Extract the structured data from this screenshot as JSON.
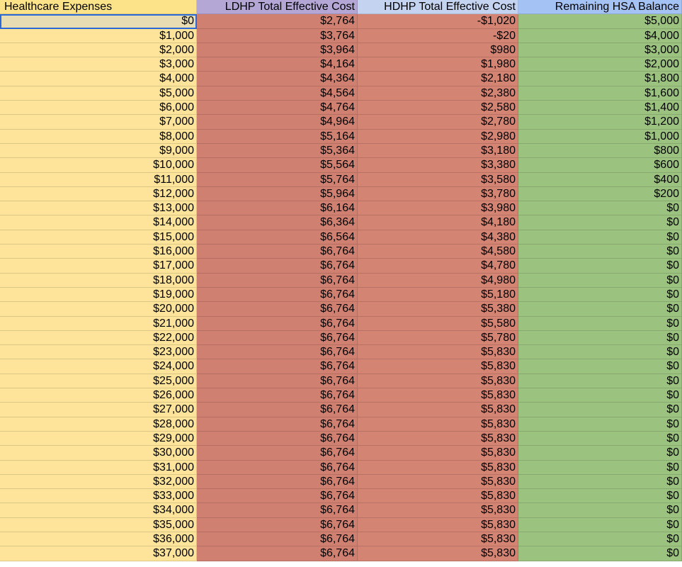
{
  "columns": [
    "Healthcare Expenses",
    "LDHP Total Effective Cost",
    "HDHP Total Effective Cost",
    "Remaining HSA Balance"
  ],
  "rows": [
    [
      "$0",
      "$2,764",
      "-$1,020",
      "$5,000"
    ],
    [
      "$1,000",
      "$3,764",
      "-$20",
      "$4,000"
    ],
    [
      "$2,000",
      "$3,964",
      "$980",
      "$3,000"
    ],
    [
      "$3,000",
      "$4,164",
      "$1,980",
      "$2,000"
    ],
    [
      "$4,000",
      "$4,364",
      "$2,180",
      "$1,800"
    ],
    [
      "$5,000",
      "$4,564",
      "$2,380",
      "$1,600"
    ],
    [
      "$6,000",
      "$4,764",
      "$2,580",
      "$1,400"
    ],
    [
      "$7,000",
      "$4,964",
      "$2,780",
      "$1,200"
    ],
    [
      "$8,000",
      "$5,164",
      "$2,980",
      "$1,000"
    ],
    [
      "$9,000",
      "$5,364",
      "$3,180",
      "$800"
    ],
    [
      "$10,000",
      "$5,564",
      "$3,380",
      "$600"
    ],
    [
      "$11,000",
      "$5,764",
      "$3,580",
      "$400"
    ],
    [
      "$12,000",
      "$5,964",
      "$3,780",
      "$200"
    ],
    [
      "$13,000",
      "$6,164",
      "$3,980",
      "$0"
    ],
    [
      "$14,000",
      "$6,364",
      "$4,180",
      "$0"
    ],
    [
      "$15,000",
      "$6,564",
      "$4,380",
      "$0"
    ],
    [
      "$16,000",
      "$6,764",
      "$4,580",
      "$0"
    ],
    [
      "$17,000",
      "$6,764",
      "$4,780",
      "$0"
    ],
    [
      "$18,000",
      "$6,764",
      "$4,980",
      "$0"
    ],
    [
      "$19,000",
      "$6,764",
      "$5,180",
      "$0"
    ],
    [
      "$20,000",
      "$6,764",
      "$5,380",
      "$0"
    ],
    [
      "$21,000",
      "$6,764",
      "$5,580",
      "$0"
    ],
    [
      "$22,000",
      "$6,764",
      "$5,780",
      "$0"
    ],
    [
      "$23,000",
      "$6,764",
      "$5,830",
      "$0"
    ],
    [
      "$24,000",
      "$6,764",
      "$5,830",
      "$0"
    ],
    [
      "$25,000",
      "$6,764",
      "$5,830",
      "$0"
    ],
    [
      "$26,000",
      "$6,764",
      "$5,830",
      "$0"
    ],
    [
      "$27,000",
      "$6,764",
      "$5,830",
      "$0"
    ],
    [
      "$28,000",
      "$6,764",
      "$5,830",
      "$0"
    ],
    [
      "$29,000",
      "$6,764",
      "$5,830",
      "$0"
    ],
    [
      "$30,000",
      "$6,764",
      "$5,830",
      "$0"
    ],
    [
      "$31,000",
      "$6,764",
      "$5,830",
      "$0"
    ],
    [
      "$32,000",
      "$6,764",
      "$5,830",
      "$0"
    ],
    [
      "$33,000",
      "$6,764",
      "$5,830",
      "$0"
    ],
    [
      "$34,000",
      "$6,764",
      "$5,830",
      "$0"
    ],
    [
      "$35,000",
      "$6,764",
      "$5,830",
      "$0"
    ],
    [
      "$36,000",
      "$6,764",
      "$5,830",
      "$0"
    ],
    [
      "$37,000",
      "$6,764",
      "$5,830",
      "$0"
    ]
  ]
}
